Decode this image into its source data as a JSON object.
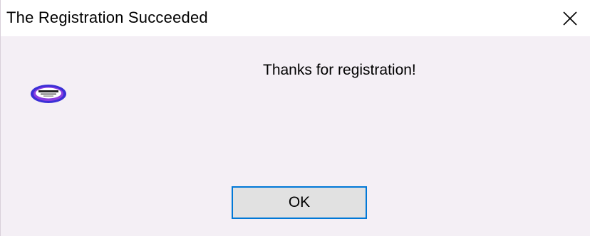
{
  "window": {
    "title": "The Registration Succeeded",
    "close_icon": "close-icon"
  },
  "dialog": {
    "logo_icon": "app-logo-icon",
    "message": "Thanks for registration!",
    "ok_label": "OK"
  },
  "colors": {
    "background": "#f4eff5",
    "titlebar": "#ffffff",
    "button_face": "#e1e1e1",
    "button_focus_border": "#0078d7",
    "logo_ring_outer": "#3b2fd6",
    "logo_ring_inner": "#8b3fe0"
  }
}
